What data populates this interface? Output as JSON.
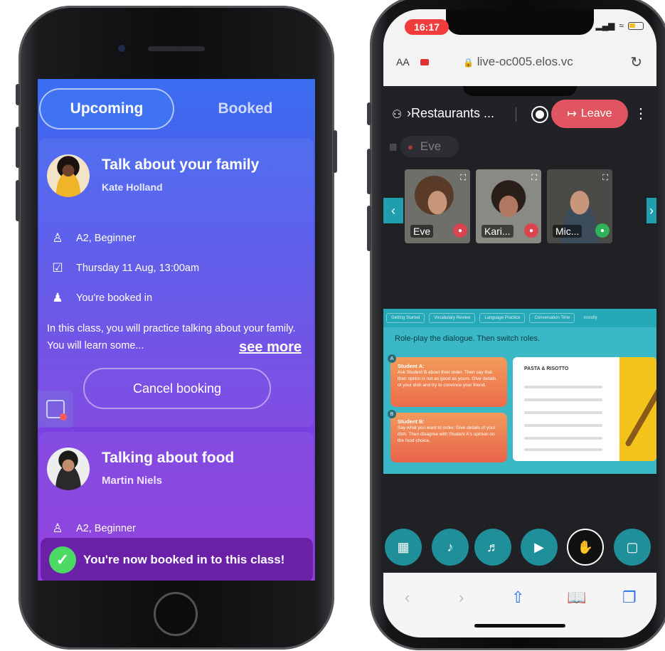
{
  "phone1": {
    "tabs": {
      "upcoming": "Upcoming",
      "booked": "Booked"
    },
    "class1": {
      "title": "Talk about your family",
      "teacher": "Kate Holland",
      "level": "A2, Beginner",
      "date": "Thursday 11 Aug, 13:00am",
      "status": "You're booked in",
      "description": "In this class, you will practice talking about your family. You will learn some...",
      "see_more": "see more",
      "cancel_label": "Cancel booking"
    },
    "class2": {
      "title": "Talking about food",
      "teacher": "Martin Niels",
      "level": "A2, Beginner"
    },
    "toast": "You're now booked in to this class!"
  },
  "phone2": {
    "status_time": "16:17",
    "address_bar": {
      "aa": "AA",
      "url": "live-oc005.elos.vc"
    },
    "room_name": "›Restaurants ...",
    "leave_label": "Leave",
    "speaker_chip": "Eve",
    "participants": [
      {
        "name": "Eve",
        "mic": "muted"
      },
      {
        "name": "Kari...",
        "mic": "muted"
      },
      {
        "name": "Mic...",
        "mic": "on"
      }
    ],
    "slide": {
      "nav": [
        "Getting Started",
        "Vocabulary Review",
        "Language Practice",
        "Conversation Time"
      ],
      "brand": "mondly",
      "instruction": "Role-play the dialogue. Then switch roles.",
      "student_a_label": "Student A:",
      "student_a_text": "Ask Student B about their order. Then say that their option is not as good as yours. Give details of your dish and try to convince your friend.",
      "student_b_label": "Student B:",
      "student_b_text": "Say what you want to order. Give details of your dish. Then disagree with Student A's opinion on the food choice.",
      "menu_title": "PASTA & RISOTTO"
    }
  },
  "colors": {
    "accent_blue": "#3b6df0",
    "accent_purple": "#8b36da",
    "teal": "#1f8f99",
    "leave_red": "#e05560",
    "success_green": "#4cd964"
  },
  "icons": [
    "level-icon",
    "calendar-check-icon",
    "people-icon",
    "calendar-icon",
    "check-icon",
    "mic-icon",
    "speaker-icon",
    "camera-icon",
    "raise-hand-icon",
    "window-icon",
    "grid-icon",
    "share-icon",
    "book-icon",
    "tabs-icon"
  ]
}
